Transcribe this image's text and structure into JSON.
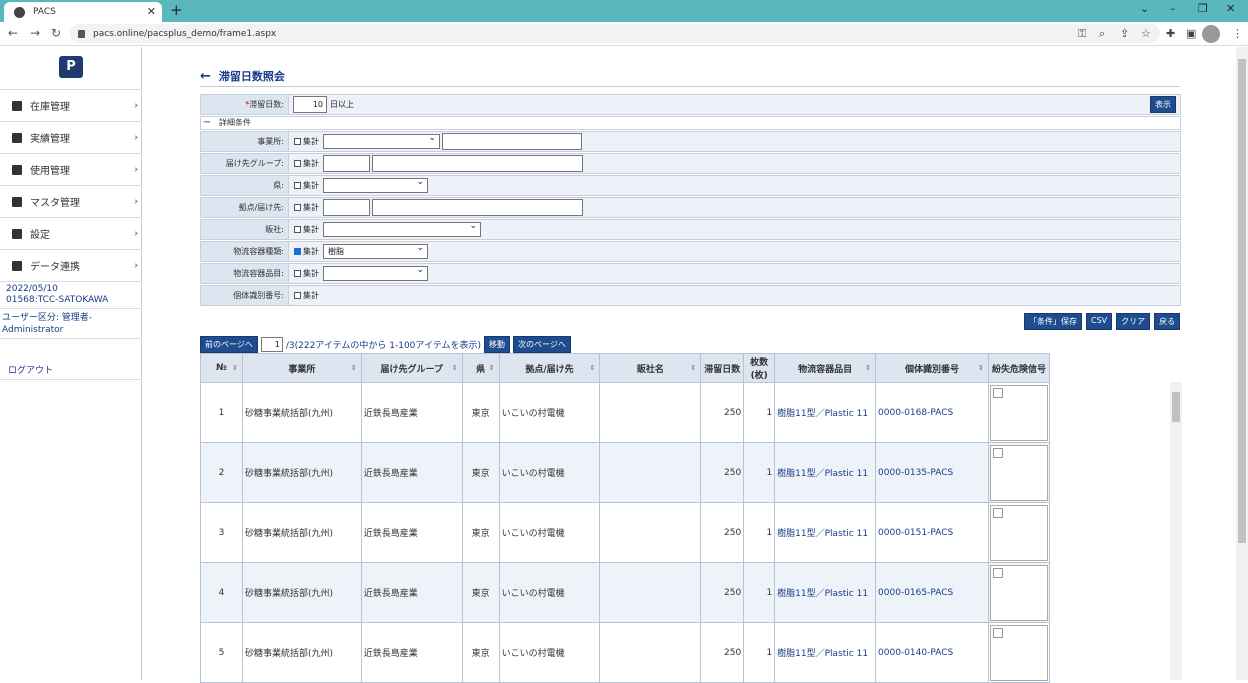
{
  "browser": {
    "tab_title": "PACS",
    "url": "pacs.online/pacsplus_demo/frame1.aspx"
  },
  "sidebar": {
    "logo": "P",
    "items": [
      {
        "label": "在庫管理",
        "icon": "hand-box-icon"
      },
      {
        "label": "実績管理",
        "icon": "table-icon"
      },
      {
        "label": "使用管理",
        "icon": "cart-icon"
      },
      {
        "label": "マスタ管理",
        "icon": "document-icon"
      },
      {
        "label": "設定",
        "icon": "gear-icon"
      },
      {
        "label": "データ連携",
        "icon": "transfer-icon"
      }
    ],
    "date": "2022/05/10",
    "user_code": "01568:TCC-SATOKAWA",
    "user_type": "ユーザー区分: 管理者-Administrator",
    "logout": "ログアウト"
  },
  "page": {
    "title": "滞留日数照会"
  },
  "form": {
    "days_label": "滞留日数:",
    "days_required": "*",
    "days_value": "10",
    "days_suffix": "日以上",
    "show_button": "表示",
    "detail_toggle": "ー",
    "detail_label": "詳細条件",
    "aggregate": "集計",
    "rows": {
      "office": "事業所:",
      "dest_group": "届け先グループ:",
      "pref": "県:",
      "base": "拠点/届け先:",
      "dealer": "販社:",
      "container_type": "物流容器種類:",
      "container_item": "物流容器品目:",
      "individual_id": "個体識別番号:"
    },
    "container_type_value": "樹脂"
  },
  "actions": {
    "save": "「条件」保存",
    "csv": "CSV",
    "clear": "クリア",
    "back": "戻る"
  },
  "pager": {
    "prev": "前のページへ",
    "page": "1",
    "info": "/3(222アイテムの中から 1-100アイテムを表示)",
    "move": "移動",
    "next": "次のページへ"
  },
  "table": {
    "headers": [
      "№",
      "事業所",
      "届け先グループ",
      "県",
      "拠点/届け先",
      "販社名",
      "滞留日数",
      "枚数(枚)",
      "物流容器品目",
      "個体識別番号",
      "紛失危険信号"
    ],
    "rows": [
      {
        "no": "1",
        "office": "砂糖事業統括部(九州)",
        "group": "近鉄長島産業",
        "pref": "東京",
        "base": "いこいの村電機",
        "dealer": "",
        "days": "250",
        "qty": "1",
        "item": "樹脂11型／Plastic 11",
        "id": "0000-0168-PACS"
      },
      {
        "no": "2",
        "office": "砂糖事業統括部(九州)",
        "group": "近鉄長島産業",
        "pref": "東京",
        "base": "いこいの村電機",
        "dealer": "",
        "days": "250",
        "qty": "1",
        "item": "樹脂11型／Plastic 11",
        "id": "0000-0135-PACS"
      },
      {
        "no": "3",
        "office": "砂糖事業統括部(九州)",
        "group": "近鉄長島産業",
        "pref": "東京",
        "base": "いこいの村電機",
        "dealer": "",
        "days": "250",
        "qty": "1",
        "item": "樹脂11型／Plastic 11",
        "id": "0000-0151-PACS"
      },
      {
        "no": "4",
        "office": "砂糖事業統括部(九州)",
        "group": "近鉄長島産業",
        "pref": "東京",
        "base": "いこいの村電機",
        "dealer": "",
        "days": "250",
        "qty": "1",
        "item": "樹脂11型／Plastic 11",
        "id": "0000-0165-PACS"
      },
      {
        "no": "5",
        "office": "砂糖事業統括部(九州)",
        "group": "近鉄長島産業",
        "pref": "東京",
        "base": "いこいの村電機",
        "dealer": "",
        "days": "250",
        "qty": "1",
        "item": "樹脂11型／Plastic 11",
        "id": "0000-0140-PACS"
      }
    ]
  }
}
